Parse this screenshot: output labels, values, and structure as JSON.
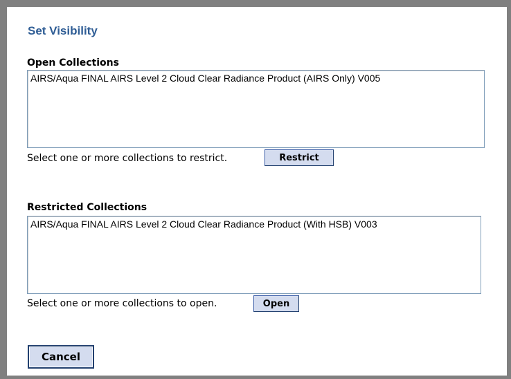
{
  "dialog": {
    "title": "Set Visibility"
  },
  "open_collections": {
    "label": "Open Collections",
    "items": [
      "AIRS/Aqua FINAL AIRS Level 2 Cloud Clear Radiance Product (AIRS Only) V005"
    ],
    "hint": "Select one or more collections to restrict.",
    "button_label": "Restrict"
  },
  "restricted_collections": {
    "label": "Restricted Collections",
    "items": [
      "AIRS/Aqua FINAL AIRS Level 2 Cloud Clear Radiance Product (With HSB) V003"
    ],
    "hint": "Select one or more collections to open.",
    "button_label": "Open"
  },
  "footer": {
    "cancel_label": "Cancel"
  }
}
